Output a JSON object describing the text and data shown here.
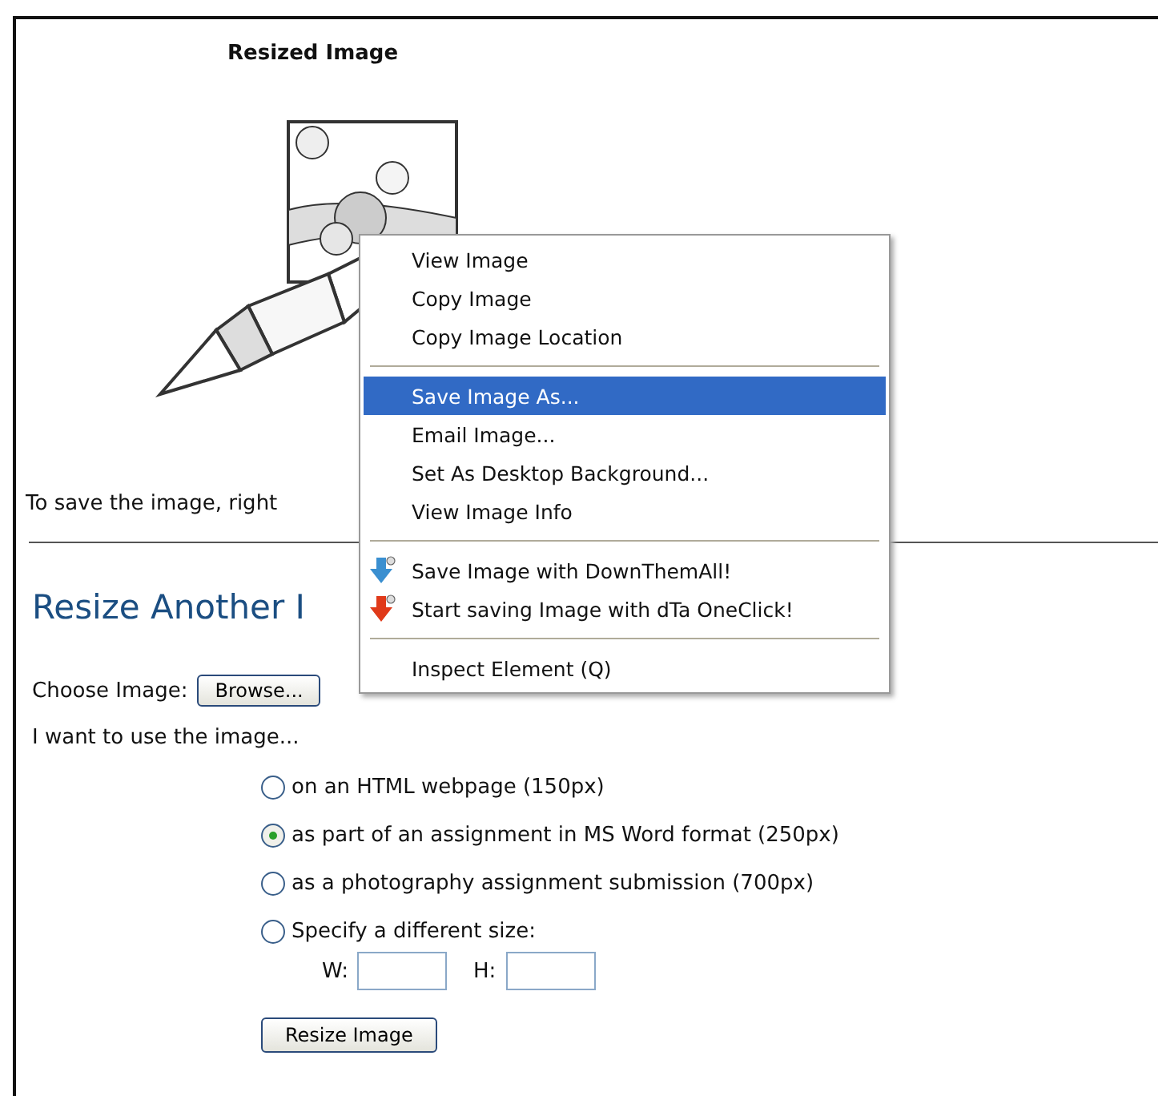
{
  "result": {
    "title": "Resized Image",
    "instructions": "To save the image, right"
  },
  "form": {
    "heading": "Resize Another I",
    "file_label": "Choose Image:",
    "browse_button": "Browse...",
    "use_label": "I want to use the image...",
    "options": [
      {
        "label": "on an HTML webpage (150px)",
        "selected": false
      },
      {
        "label": "as part of an assignment in MS Word format (250px)",
        "selected": true
      },
      {
        "label": "as a photography assignment submission (700px)",
        "selected": false
      },
      {
        "label": "Specify a different size:",
        "selected": false
      }
    ],
    "width_label": "W:",
    "height_label": "H:",
    "submit_button": "Resize Image"
  },
  "context_menu": {
    "items": [
      {
        "kind": "item",
        "label": "View Image",
        "selected": false
      },
      {
        "kind": "item",
        "label": "Copy Image",
        "selected": false
      },
      {
        "kind": "item",
        "label": "Copy Image Location",
        "selected": false
      },
      {
        "kind": "separator"
      },
      {
        "kind": "item",
        "label": "Save Image As...",
        "selected": true
      },
      {
        "kind": "item",
        "label": "Email Image...",
        "selected": false
      },
      {
        "kind": "item",
        "label": "Set As Desktop Background...",
        "selected": false
      },
      {
        "kind": "item",
        "label": "View Image Info",
        "selected": false
      },
      {
        "kind": "separator"
      },
      {
        "kind": "icon_item",
        "label": "Save Image with DownThemAll!",
        "color": "#3a8fd0",
        "selected": false
      },
      {
        "kind": "icon_item",
        "label": "Start saving Image with dTa OneClick!",
        "color": "#e03a1a",
        "selected": false
      },
      {
        "kind": "separator"
      },
      {
        "kind": "item",
        "label": "Inspect Element (Q)",
        "selected": false
      }
    ]
  }
}
